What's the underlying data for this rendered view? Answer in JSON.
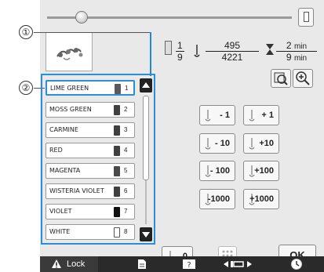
{
  "callouts": {
    "c1": "①",
    "c2": "②"
  },
  "threads": [
    {
      "name": "LIME GREEN",
      "number": "1",
      "color": "#5a5a5a"
    },
    {
      "name": "MOSS GREEN",
      "number": "2",
      "color": "#404040"
    },
    {
      "name": "CARMINE",
      "number": "3",
      "color": "#404040"
    },
    {
      "name": "RED",
      "number": "4",
      "color": "#404040"
    },
    {
      "name": "MAGENTA",
      "number": "5",
      "color": "#4a4a4a"
    },
    {
      "name": "WISTERIA VIOLET",
      "number": "6",
      "color": "#404040"
    },
    {
      "name": "VIOLET",
      "number": "7",
      "color": "#111111"
    },
    {
      "name": "WHITE",
      "number": "8",
      "color": "#ffffff"
    }
  ],
  "info": {
    "thread_current": "1",
    "thread_total": "9",
    "stitch_current": "495",
    "stitch_total": "4221",
    "time_current": "2",
    "time_total": "9",
    "time_unit": "min"
  },
  "steps": [
    {
      "label": "- 1"
    },
    {
      "label": "+ 1"
    },
    {
      "label": "- 10"
    },
    {
      "label": "+10"
    },
    {
      "label": "- 100"
    },
    {
      "label": "+100"
    },
    {
      "label": "-1000"
    },
    {
      "label": "+1000"
    }
  ],
  "reset_label": "0",
  "ok_label": "OK",
  "bottom": {
    "lock_label": "Lock"
  },
  "colors": {
    "accent": "#2a8fd8",
    "panel": "#e9e9e9",
    "bar": "#2a2a2a"
  }
}
